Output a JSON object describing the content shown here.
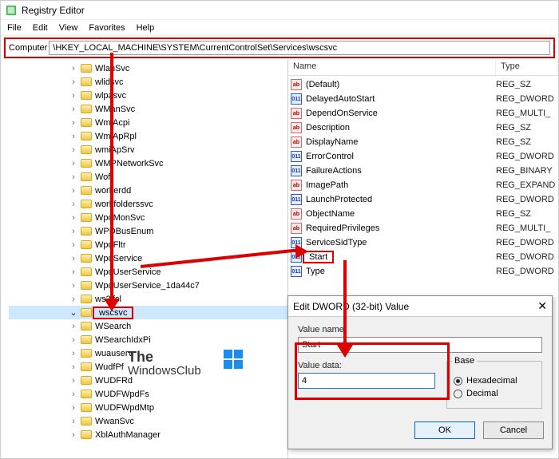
{
  "titlebar": {
    "title": "Registry Editor"
  },
  "menubar": {
    "file": "File",
    "edit": "Edit",
    "view": "View",
    "favorites": "Favorites",
    "help": "Help"
  },
  "addressbar": {
    "label": "Computer",
    "path": "\\HKEY_LOCAL_MACHINE\\SYSTEM\\CurrentControlSet\\Services\\wscsvc"
  },
  "tree": {
    "items": [
      {
        "label": "WlanSvc",
        "expand": "right"
      },
      {
        "label": "wlidsvc",
        "expand": "right"
      },
      {
        "label": "wlpasvc",
        "expand": "right"
      },
      {
        "label": "WManSvc",
        "expand": "right"
      },
      {
        "label": "WmiAcpi",
        "expand": "right"
      },
      {
        "label": "WmiApRpl",
        "expand": "right"
      },
      {
        "label": "wmiApSrv",
        "expand": "right"
      },
      {
        "label": "WMPNetworkSvc",
        "expand": "right"
      },
      {
        "label": "Wof",
        "expand": "right"
      },
      {
        "label": "workerdd",
        "expand": "right"
      },
      {
        "label": "workfolderssvc",
        "expand": "right"
      },
      {
        "label": "WpdMonSvc",
        "expand": "right"
      },
      {
        "label": "WPDBusEnum",
        "expand": "right"
      },
      {
        "label": "WpdFltr",
        "expand": "right"
      },
      {
        "label": "WpdService",
        "expand": "right"
      },
      {
        "label": "WpdUserService",
        "expand": "right"
      },
      {
        "label": "WpdUserService_1da44c7",
        "expand": "right"
      },
      {
        "label": "ws2ifsl",
        "expand": "right"
      },
      {
        "label": "wscsvc",
        "expand": "down",
        "selected": true,
        "highlight": true
      },
      {
        "label": "WSearch",
        "expand": "right"
      },
      {
        "label": "WSearchIdxPi",
        "expand": "right"
      },
      {
        "label": "wuauserv",
        "expand": "right"
      },
      {
        "label": "WudfPf",
        "expand": "right"
      },
      {
        "label": "WUDFRd",
        "expand": "right"
      },
      {
        "label": "WUDFWpdFs",
        "expand": "right"
      },
      {
        "label": "WUDFWpdMtp",
        "expand": "right"
      },
      {
        "label": "WwanSvc",
        "expand": "right"
      },
      {
        "label": "XblAuthManager",
        "expand": "right"
      }
    ]
  },
  "list": {
    "headers": {
      "name": "Name",
      "type": "Type"
    },
    "rows": [
      {
        "icon": "str",
        "name": "(Default)",
        "type": "REG_SZ"
      },
      {
        "icon": "bin",
        "name": "DelayedAutoStart",
        "type": "REG_DWORD"
      },
      {
        "icon": "str",
        "name": "DependOnService",
        "type": "REG_MULTI_"
      },
      {
        "icon": "str",
        "name": "Description",
        "type": "REG_SZ"
      },
      {
        "icon": "str",
        "name": "DisplayName",
        "type": "REG_SZ"
      },
      {
        "icon": "bin",
        "name": "ErrorControl",
        "type": "REG_DWORD"
      },
      {
        "icon": "bin",
        "name": "FailureActions",
        "type": "REG_BINARY"
      },
      {
        "icon": "str",
        "name": "ImagePath",
        "type": "REG_EXPAND"
      },
      {
        "icon": "bin",
        "name": "LaunchProtected",
        "type": "REG_DWORD"
      },
      {
        "icon": "str",
        "name": "ObjectName",
        "type": "REG_SZ"
      },
      {
        "icon": "str",
        "name": "RequiredPrivileges",
        "type": "REG_MULTI_"
      },
      {
        "icon": "bin",
        "name": "ServiceSidType",
        "type": "REG_DWORD"
      },
      {
        "icon": "bin",
        "name": "Start",
        "type": "REG_DWORD",
        "highlight": true
      },
      {
        "icon": "bin",
        "name": "Type",
        "type": "REG_DWORD"
      }
    ]
  },
  "dialog": {
    "title": "Edit DWORD (32-bit) Value",
    "value_name_label": "Value name:",
    "value_name": "Start",
    "value_data_label": "Value data:",
    "value_data": "4",
    "base_label": "Base",
    "hex_label": "Hexadecimal",
    "dec_label": "Decimal",
    "base_selected": "hex",
    "ok": "OK",
    "cancel": "Cancel"
  },
  "watermark": {
    "line1": "The",
    "line2": "WindowsClub"
  }
}
